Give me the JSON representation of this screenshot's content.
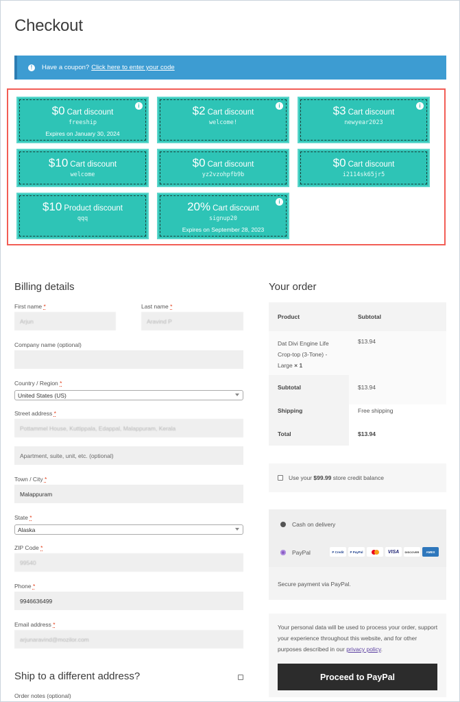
{
  "page": {
    "title": "Checkout"
  },
  "coupon_notice": {
    "text": "Have a coupon?",
    "link": "Click here to enter your code"
  },
  "coupons": [
    {
      "amount": "$0",
      "type": "Cart discount",
      "code": "freeship",
      "expiry": "Expires on January 30, 2024",
      "info": true
    },
    {
      "amount": "$2",
      "type": "Cart discount",
      "code": "welcome!",
      "expiry": "",
      "info": true
    },
    {
      "amount": "$3",
      "type": "Cart discount",
      "code": "newyear2023",
      "expiry": "",
      "info": true
    },
    {
      "amount": "$10",
      "type": "Cart discount",
      "code": "welcome",
      "expiry": "",
      "info": false
    },
    {
      "amount": "$0",
      "type": "Cart discount",
      "code": "yz2vzohpfb9b",
      "expiry": "",
      "info": false
    },
    {
      "amount": "$0",
      "type": "Cart discount",
      "code": "i2114sk65jr5",
      "expiry": "",
      "info": false
    },
    {
      "amount": "$10",
      "type": "Product discount",
      "code": "qqq",
      "expiry": "",
      "info": false
    },
    {
      "amount": "20%",
      "type": "Cart discount",
      "code": "signup20",
      "expiry": "Expires on September 28, 2023",
      "info": true
    }
  ],
  "billing": {
    "heading": "Billing details",
    "required_mark": "*",
    "first_name": {
      "label": "First name",
      "value": "Arjun"
    },
    "last_name": {
      "label": "Last name",
      "value": "Aravind P"
    },
    "company": {
      "label": "Company name (optional)",
      "value": ""
    },
    "country": {
      "label": "Country / Region",
      "value": "United States (US)"
    },
    "street": {
      "label": "Street address",
      "value": "Pottammel House, Kuttippala, Edappal, Malappuram, Kerala"
    },
    "apartment": {
      "placeholder": "Apartment, suite, unit, etc. (optional)"
    },
    "city": {
      "label": "Town / City",
      "value": "Malappuram"
    },
    "state": {
      "label": "State",
      "value": "Alaska"
    },
    "zip": {
      "label": "ZIP Code",
      "value": "99540"
    },
    "phone": {
      "label": "Phone",
      "value": "9946636499"
    },
    "email": {
      "label": "Email address",
      "value": "arjunaravind@mozilor.com"
    }
  },
  "shipping": {
    "heading": "Ship to a different address?",
    "checked": false
  },
  "order_notes": {
    "label": "Order notes (optional)"
  },
  "order": {
    "heading": "Your order",
    "col_product": "Product",
    "col_subtotal": "Subtotal",
    "item_name_lines": [
      "Dat Divi Engine Life",
      "Crop-top (3-Tone) -",
      "Large"
    ],
    "item_qty": "× 1",
    "item_price": "$13.94",
    "subtotal_label": "Subtotal",
    "subtotal_value": "$13.94",
    "shipping_label": "Shipping",
    "shipping_value": "Free shipping",
    "total_label": "Total",
    "total_value": "$13.94"
  },
  "store_credit": {
    "prefix": "Use your",
    "amount": "$99.99",
    "suffix": "store credit balance"
  },
  "payment": {
    "cod_label": "Cash on delivery",
    "paypal_label": "PayPal",
    "cards": [
      "PayPal Credit",
      "PayPal",
      "Mastercard",
      "VISA",
      "DISCOVER",
      "AMEX"
    ],
    "description": "Secure payment via PayPal."
  },
  "privacy": {
    "text": "Your personal data will be used to process your order, support your experience throughout this website, and for other purposes described in our",
    "link": "privacy policy",
    "end": "."
  },
  "proceed_button": "Proceed to PayPal"
}
